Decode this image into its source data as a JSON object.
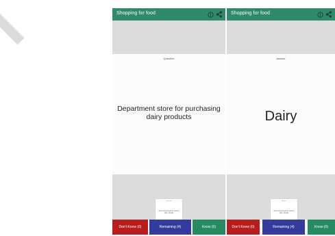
{
  "colors": {
    "app_bar": "#2f8a6a",
    "dont_know": "#b81d1d",
    "remaining": "#333c9c",
    "know": "#268a62",
    "band": "#dcdcdc"
  },
  "question_screen": {
    "title": "Shopping for food",
    "icons": [
      "help-circle-icon",
      "share-icon"
    ],
    "card_label": "Question",
    "card_text": "Department store for purchasing dairy products",
    "preview_text": "Store associated by having dairy details",
    "buttons": {
      "dont_know": "Don't Know (0)",
      "remaining": "Remaining (4)",
      "know": "Know (0)"
    }
  },
  "answer_screen": {
    "title": "Shopping for food",
    "icons": [
      "help-circle-icon",
      "share-icon"
    ],
    "card_label": "Answer",
    "card_text": "Dairy",
    "preview_text": "Store associated by having dairy details",
    "buttons": {
      "dont_know": "Don't Know (0)",
      "remaining": "Remaining (4)",
      "know": "Know (0)"
    }
  }
}
